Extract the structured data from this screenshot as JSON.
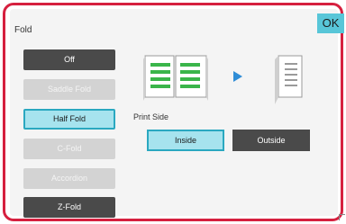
{
  "screen": {
    "title": "Fold",
    "ok_label": "OK"
  },
  "fold_options": [
    {
      "label": "Off",
      "state": "enabled"
    },
    {
      "label": "Saddle Fold",
      "state": "disabled"
    },
    {
      "label": "Half Fold",
      "state": "selected"
    },
    {
      "label": "C-Fold",
      "state": "disabled"
    },
    {
      "label": "Accordion",
      "state": "disabled"
    },
    {
      "label": "Z-Fold",
      "state": "enabled"
    }
  ],
  "print_side": {
    "label": "Print Side",
    "options": [
      {
        "label": "Inside",
        "state": "selected"
      },
      {
        "label": "Outside",
        "state": "enabled"
      }
    ]
  },
  "illustration": {
    "from_icon": "open-book-icon",
    "arrow_icon": "arrow-right-icon",
    "to_icon": "folded-page-icon",
    "accent_green": "#3ab54a",
    "accent_blue": "#2f8dd6"
  },
  "colors": {
    "frame": "#d6203f",
    "ok": "#58c6d8",
    "selected_fill": "#a6e3ee",
    "selected_border": "#2aa8c0",
    "dark_button": "#4a4a4a",
    "disabled_button": "#d3d3d3"
  }
}
